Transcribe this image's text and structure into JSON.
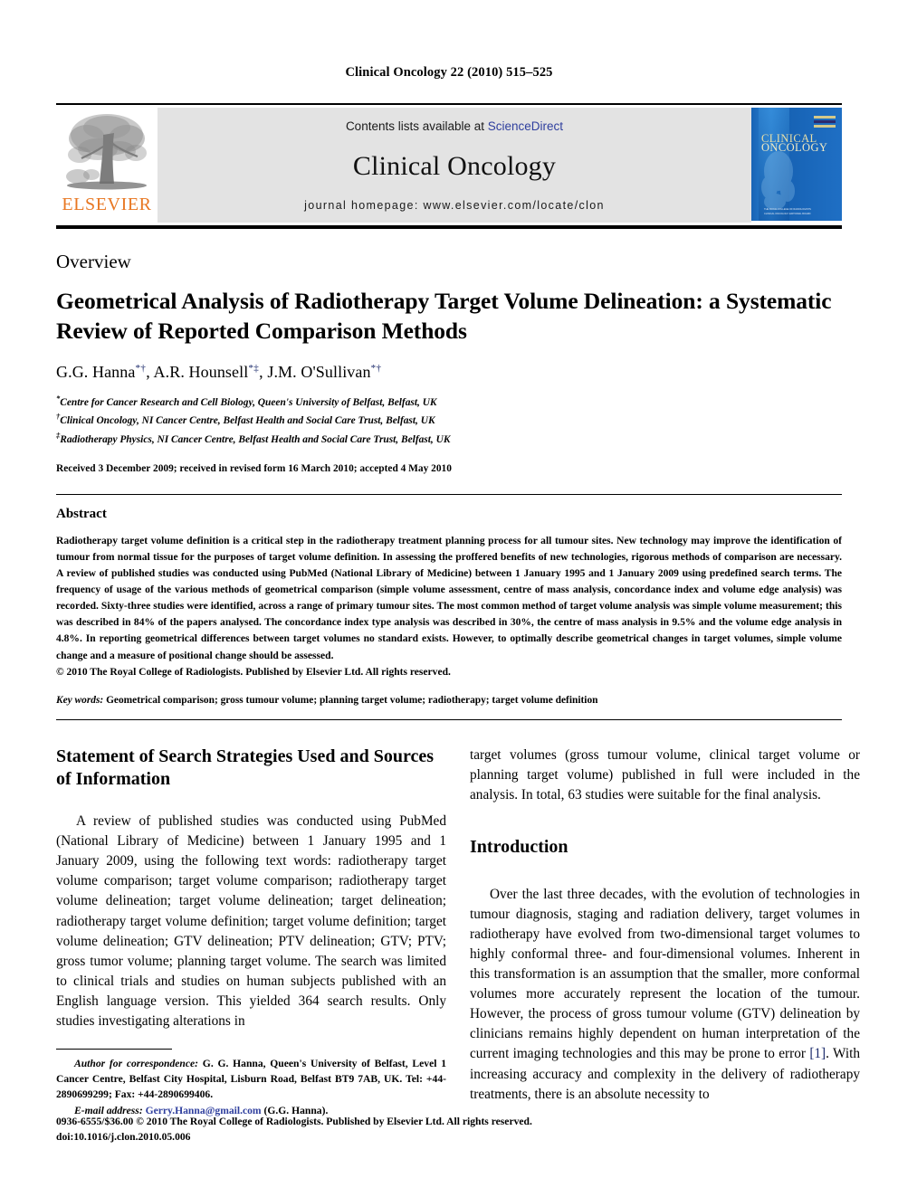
{
  "running_head": "Clinical Oncology 22 (2010) 515–525",
  "masthead": {
    "publisher_wordmark": "ELSEVIER",
    "publisher_logo_icon": "elsevier-tree-icon",
    "contents_prefix": "Contents lists available at ",
    "contents_link": "ScienceDirect",
    "journal_title": "Clinical Oncology",
    "homepage": "journal homepage: www.elsevier.com/locate/clon",
    "cover": {
      "line1": "CLINICAL",
      "line2": "ONCOLOGY",
      "caption1": "THE ROYAL COLLEGE OF RADIOLOGISTS",
      "caption2": "CLINICAL ONCOLOGY EDITORIAL BOARD"
    },
    "colors": {
      "elsevier_orange": "#E87722",
      "link_blue": "#2f3f9e",
      "band_grey": "#e3e3e3",
      "cover_blue": "#1f6fc4",
      "cover_gold": "#e8dfa8"
    }
  },
  "article": {
    "type_label": "Overview",
    "title": "Geometrical Analysis of Radiotherapy Target Volume Delineation: a Systematic Review of Reported Comparison Methods",
    "authors": [
      {
        "name": "G.G. Hanna",
        "marks": "*†"
      },
      {
        "name": "A.R. Hounsell",
        "marks": "*‡"
      },
      {
        "name": "J.M. O'Sullivan",
        "marks": "*†"
      }
    ],
    "affiliations": [
      {
        "mark": "*",
        "text": "Centre for Cancer Research and Cell Biology, Queen's University of Belfast, Belfast, UK"
      },
      {
        "mark": "†",
        "text": "Clinical Oncology, NI Cancer Centre, Belfast Health and Social Care Trust, Belfast, UK"
      },
      {
        "mark": "‡",
        "text": "Radiotherapy Physics, NI Cancer Centre, Belfast Health and Social Care Trust, Belfast, UK"
      }
    ],
    "received_line": "Received 3 December 2009; received in revised form 16 March 2010; accepted 4 May 2010"
  },
  "abstract": {
    "heading": "Abstract",
    "body": "Radiotherapy target volume definition is a critical step in the radiotherapy treatment planning process for all tumour sites. New technology may improve the identification of tumour from normal tissue for the purposes of target volume definition. In assessing the proffered benefits of new technologies, rigorous methods of comparison are necessary. A review of published studies was conducted using PubMed (National Library of Medicine) between 1 January 1995 and 1 January 2009 using predefined search terms. The frequency of usage of the various methods of geometrical comparison (simple volume assessment, centre of mass analysis, concordance index and volume edge analysis) was recorded. Sixty-three studies were identified, across a range of primary tumour sites. The most common method of target volume analysis was simple volume measurement; this was described in 84% of the papers analysed. The concordance index type analysis was described in 30%, the centre of mass analysis in 9.5% and the volume edge analysis in 4.8%. In reporting geometrical differences between target volumes no standard exists. However, to optimally describe geometrical changes in target volumes, simple volume change and a measure of positional change should be assessed.",
    "copyright": "© 2010 The Royal College of Radiologists. Published by Elsevier Ltd. All rights reserved.",
    "keywords_label": "Key words:",
    "keywords_text": " Geometrical comparison; gross tumour volume; planning target volume; radiotherapy; target volume definition"
  },
  "body": {
    "left_column": {
      "section_heading": "Statement of Search Strategies Used and Sources of Information",
      "paragraph": "A review of published studies was conducted using PubMed (National Library of Medicine) between 1 January 1995 and 1 January 2009, using the following text words: radiotherapy target volume comparison; target volume comparison; radiotherapy target volume delineation; target volume delineation; target delineation; radiotherapy target volume definition; target volume definition; target volume delineation; GTV delineation; PTV delineation; GTV; PTV; gross tumor volume; planning target volume. The search was limited to clinical trials and studies on human subjects published with an English language version. This yielded 364 search results. Only studies investigating alterations in"
    },
    "right_column": {
      "continuation": "target volumes (gross tumour volume, clinical target volume or planning target volume) published in full were included in the analysis. In total, 63 studies were suitable for the final analysis.",
      "section_heading": "Introduction",
      "paragraph_part1": "Over the last three decades, with the evolution of technologies in tumour diagnosis, staging and radiation delivery, target volumes in radiotherapy have evolved from two-dimensional target volumes to highly conformal three- and four-dimensional volumes. Inherent in this transformation is an assumption that the smaller, more conformal volumes more accurately represent the location of the tumour. However, the process of gross tumour volume (GTV) delineation by clinicians remains highly dependent on human interpretation of the current imaging technologies and this may be prone to error ",
      "reference_marker": "[1]",
      "paragraph_part2": ". With increasing accuracy and complexity in the delivery of radiotherapy treatments, there is an absolute necessity to"
    }
  },
  "footnote": {
    "correspondence_label": "Author for correspondence:",
    "correspondence_text": " G. G. Hanna, Queen's University of Belfast, Level 1 Cancer Centre, Belfast City Hospital, Lisburn Road, Belfast BT9 7AB, UK. Tel: +44-2890699299; Fax: +44-2890699406.",
    "email_label": "E-mail address:",
    "email": "Gerry.Hanna@gmail.com",
    "email_suffix": " (G.G. Hanna)."
  },
  "page_footer": {
    "issn_line": "0936-6555/$36.00 © 2010 The Royal College of Radiologists. Published by Elsevier Ltd. All rights reserved.",
    "doi_line": "doi:10.1016/j.clon.2010.05.006"
  }
}
